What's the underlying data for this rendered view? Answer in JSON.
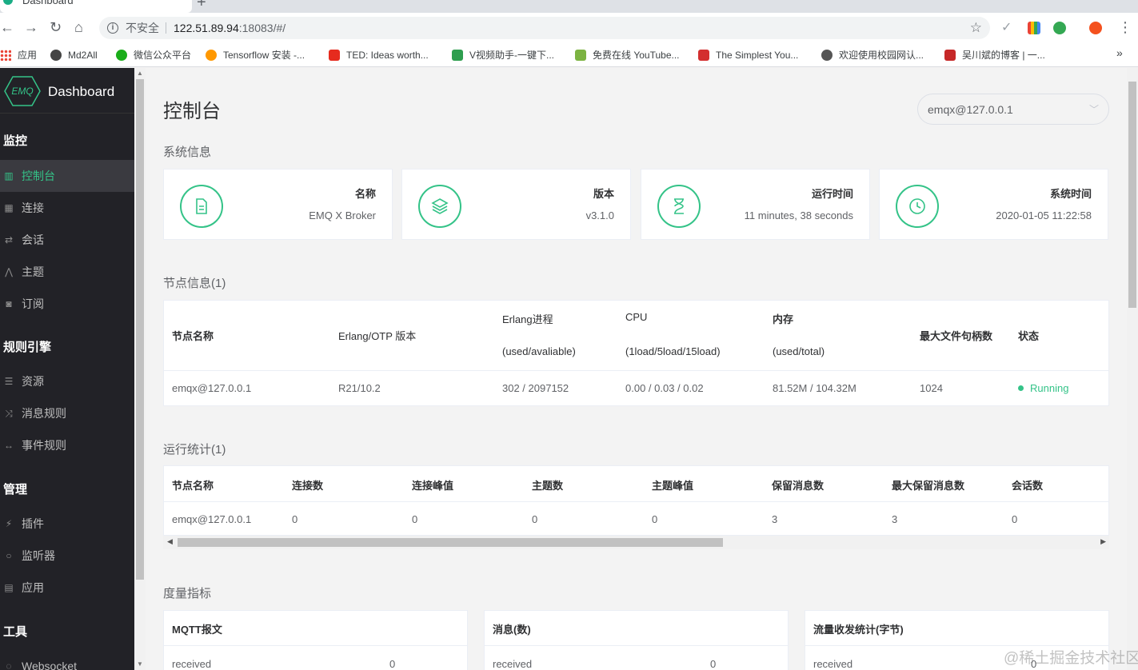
{
  "browser": {
    "tab_title": "Dashboard",
    "security_label": "不安全",
    "url_host": "122.51.89.94",
    "url_rest": ":18083/#/",
    "bookmarks": [
      {
        "label": "应用",
        "color": "#ea4335"
      },
      {
        "label": "Md2All",
        "color": "#444444"
      },
      {
        "label": "微信公众平台",
        "color": "#1aad19"
      },
      {
        "label": "Tensorflow 安装 -...",
        "color": "#ff9800"
      },
      {
        "label": "TED: Ideas worth...",
        "color": "#e62b1e"
      },
      {
        "label": "V视频助手-一键下...",
        "color": "#2e9e4f"
      },
      {
        "label": "免费在线 YouTube...",
        "color": "#7cb342"
      },
      {
        "label": "The Simplest You...",
        "color": "#d32f2f"
      },
      {
        "label": "欢迎使用校园网认...",
        "color": "#555555"
      },
      {
        "label": "吴川斌的博客 | 一...",
        "color": "#c62828"
      }
    ],
    "more": "»"
  },
  "sidebar": {
    "logo_text": "EMQ",
    "app_title": "Dashboard",
    "groups": [
      {
        "title": "监控",
        "items": [
          {
            "label": "控制台",
            "icon": "bar-chart-icon",
            "glyph": "▥",
            "active": true
          },
          {
            "label": "连接",
            "icon": "server-icon",
            "glyph": "▦"
          },
          {
            "label": "会话",
            "icon": "swap-icon",
            "glyph": "⇄"
          },
          {
            "label": "主题",
            "icon": "share-icon",
            "glyph": "⋀"
          },
          {
            "label": "订阅",
            "icon": "rss-icon",
            "glyph": "◙"
          }
        ]
      },
      {
        "title": "规则引擎",
        "items": [
          {
            "label": "资源",
            "icon": "list-icon",
            "glyph": "☰"
          },
          {
            "label": "消息规则",
            "icon": "shuffle-icon",
            "glyph": "⤨"
          },
          {
            "label": "事件规则",
            "icon": "arrows-icon",
            "glyph": "↔"
          }
        ]
      },
      {
        "title": "管理",
        "items": [
          {
            "label": "插件",
            "icon": "plug-icon",
            "glyph": "⚡"
          },
          {
            "label": "监听器",
            "icon": "ring-icon",
            "glyph": "○"
          },
          {
            "label": "应用",
            "icon": "box-icon",
            "glyph": "▤"
          }
        ]
      },
      {
        "title": "工具",
        "items": [
          {
            "label": "Websocket",
            "icon": "socket-icon",
            "glyph": "◌"
          }
        ]
      }
    ]
  },
  "main": {
    "title": "控制台",
    "node_select": "emqx@127.0.0.1",
    "system_info": {
      "title": "系统信息",
      "cards": [
        {
          "label": "名称",
          "value": "EMQ X Broker",
          "icon": "document-icon"
        },
        {
          "label": "版本",
          "value": "v3.1.0",
          "icon": "layers-icon"
        },
        {
          "label": "运行时间",
          "value": "11 minutes, 38 seconds",
          "icon": "hourglass-icon"
        },
        {
          "label": "系统时间",
          "value": "2020-01-05 11:22:58",
          "icon": "clock-icon"
        }
      ]
    },
    "nodes": {
      "title": "节点信息(1)",
      "headers": {
        "name": "节点名称",
        "otp": "Erlang/OTP 版本",
        "proc_a": "Erlang进程",
        "proc_b": "(used/avaliable)",
        "cpu_a": "CPU",
        "cpu_b": "(1load/5load/15load)",
        "mem_a": "内存",
        "mem_b": "(used/total)",
        "fd": "最大文件句柄数",
        "status": "状态"
      },
      "row": {
        "name": "emqx@127.0.0.1",
        "otp": "R21/10.2",
        "proc": "302 / 2097152",
        "cpu": "0.00 / 0.03 / 0.02",
        "mem": "81.52M / 104.32M",
        "fd": "1024",
        "status": "Running"
      }
    },
    "stats": {
      "title": "运行统计(1)",
      "headers": [
        "节点名称",
        "连接数",
        "连接峰值",
        "主题数",
        "主题峰值",
        "保留消息数",
        "最大保留消息数",
        "会话数"
      ],
      "row": [
        "emqx@127.0.0.1",
        "0",
        "0",
        "0",
        "0",
        "3",
        "3",
        "0"
      ]
    },
    "metrics": {
      "title": "度量指标",
      "cards": [
        {
          "title": "MQTT报文",
          "label": "received",
          "value": "0"
        },
        {
          "title": "消息(数)",
          "label": "received",
          "value": "0"
        },
        {
          "title": "流量收发统计(字节)",
          "label": "received",
          "value": "0"
        }
      ]
    }
  },
  "watermark": "@稀土掘金技术社区",
  "colors": {
    "accent": "#34c388",
    "sidebar_bg": "#222227"
  }
}
